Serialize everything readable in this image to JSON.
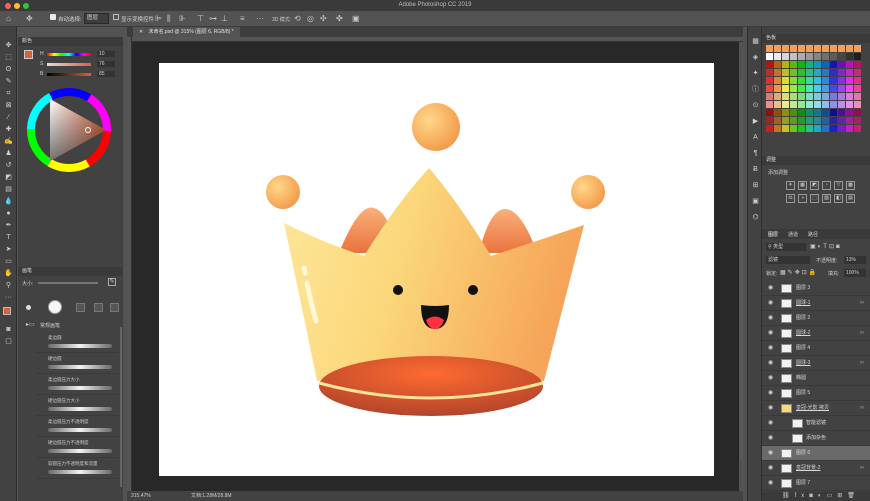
{
  "app": {
    "title": "Adobe Photoshop CC 2019",
    "traffic_colors": [
      "#ff5f57",
      "#febc2e",
      "#28c840"
    ]
  },
  "options_bar": {
    "home_icon": "home-icon",
    "move_icon": "move-tool-icon",
    "auto_select_label": "自动选择:",
    "auto_select_value": "图层",
    "show_transform_label": "显示变换控件"
  },
  "document_tab": {
    "label": "未命名.psd @ 315% (图层 6, RGB/8) *"
  },
  "status": {
    "zoom": "315.47%",
    "doc_size": "文档:1.28M/28.8M"
  },
  "color_panel": {
    "title": "颜色",
    "sliders": [
      {
        "label": "H",
        "value": "10"
      },
      {
        "label": "S",
        "value": "76"
      },
      {
        "label": "B",
        "value": "85"
      }
    ],
    "fg_color": "#d8623a",
    "bg_color": "#ffffff"
  },
  "brush_panel": {
    "title": "画笔",
    "size_label": "大小:",
    "group_label": "常规画笔",
    "brushes": [
      "柔边圆",
      "硬边圆",
      "柔边圆压力大小",
      "硬边圆压力大小",
      "柔边圆压力不透明度",
      "硬边圆压力不透明度",
      "软圆压力不透明度和流量"
    ]
  },
  "swatches_panel": {
    "title": "色板"
  },
  "adjustments_panel": {
    "title": "调整",
    "add_label": "添加调整"
  },
  "layers_panel": {
    "tabs": [
      "图层",
      "通道",
      "路径"
    ],
    "kind_label": "类型",
    "blend_mode": "滤镜",
    "opacity_label": "不透明度:",
    "opacity_value": "13%",
    "lock_label": "锁定:",
    "fill_label": "填充:",
    "fill_value": "100%",
    "layers": [
      {
        "name": "图层 3",
        "linked": false,
        "selected": false
      },
      {
        "name": "圆球-1",
        "linked": true,
        "selected": false
      },
      {
        "name": "图层 2",
        "linked": false,
        "selected": false
      },
      {
        "name": "圆球-2",
        "linked": true,
        "selected": false
      },
      {
        "name": "图层 4",
        "linked": false,
        "selected": false
      },
      {
        "name": "圆球-3",
        "linked": true,
        "selected": false
      },
      {
        "name": "椭圆",
        "linked": false,
        "selected": false
      },
      {
        "name": "图层 5",
        "linked": false,
        "selected": false
      },
      {
        "name": "皇冠-光影 拷贝",
        "linked": true,
        "selected": false
      },
      {
        "name": "智能滤镜",
        "linked": false,
        "selected": false
      },
      {
        "name": "添加杂色",
        "linked": false,
        "selected": false
      },
      {
        "name": "图层 6",
        "linked": false,
        "selected": true
      },
      {
        "name": "皇冠背景-2",
        "linked": true,
        "selected": false
      },
      {
        "name": "图层 7",
        "linked": false,
        "selected": false
      }
    ]
  },
  "canvas": {
    "crown_light": "#fbe38a",
    "crown_dark": "#f6a95a",
    "interior_color": "#e85a2b",
    "ball_color": "#f7b25a"
  }
}
